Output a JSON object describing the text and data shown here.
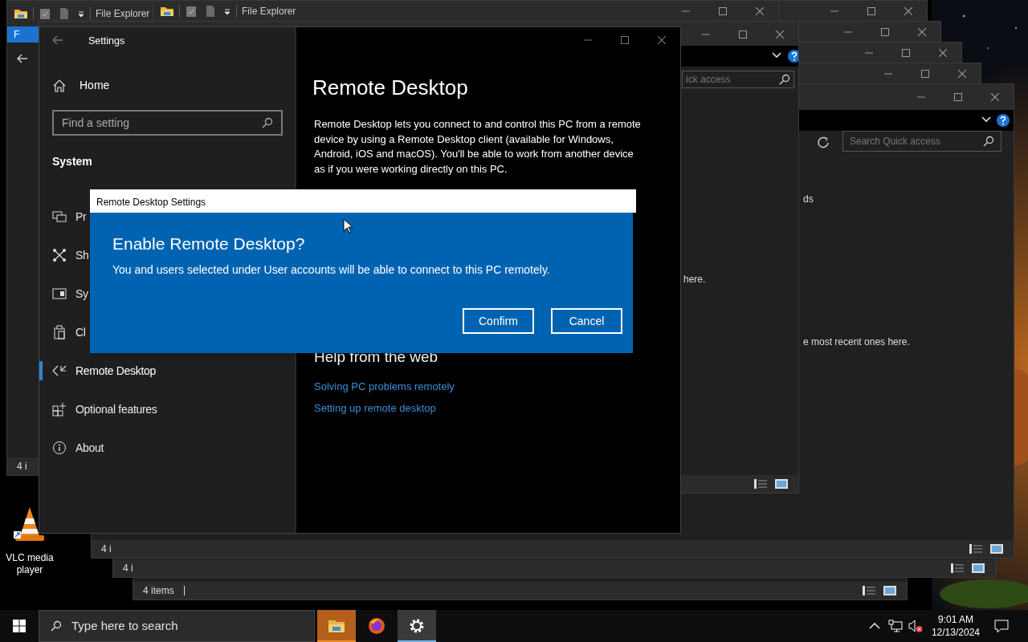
{
  "explorer_windows": [
    {
      "title": "File Explorer",
      "file_tab": "F",
      "status": "4 i"
    },
    {
      "title": "File Explorer"
    },
    {
      "search": {
        "placeholder": "ick access"
      },
      "texts": [
        "here."
      ]
    },
    {
      "search": {
        "placeholder": "Search Quick access"
      },
      "texts": [
        "ds",
        "e most recent ones here."
      ],
      "status": "4 i"
    },
    {
      "status": "4 i"
    },
    {
      "status": "4 items"
    }
  ],
  "settings": {
    "title": "Settings",
    "home": "Home",
    "search": {
      "placeholder": "Find a setting"
    },
    "section": "System",
    "nav": [
      {
        "label": "Pr",
        "selected": false
      },
      {
        "label": "Sh",
        "selected": false
      },
      {
        "label": "Sy",
        "selected": false
      },
      {
        "label": "Cl",
        "selected": false
      },
      {
        "label": "Remote Desktop",
        "selected": true
      },
      {
        "label": "Optional features",
        "selected": false
      },
      {
        "label": "About",
        "selected": false
      }
    ],
    "heading": "Remote Desktop",
    "description": "Remote Desktop lets you connect to and control this PC from a remote device by using a Remote Desktop client (available for Windows, Android, iOS and macOS). You'll be able to work from another device as if you were working directly on this PC.",
    "help_heading": "Help from the web",
    "links": [
      "Solving PC problems remotely",
      "Setting up remote desktop"
    ]
  },
  "dialog": {
    "title": "Remote Desktop Settings",
    "heading": "Enable Remote Desktop?",
    "message": "You and users selected under User accounts will be able to connect to this PC remotely.",
    "buttons": [
      "Confirm",
      "Cancel"
    ]
  },
  "desktop_icons": [
    {
      "label": "VLC media player"
    }
  ],
  "taskbar": {
    "search": {
      "placeholder": "Type here to search"
    },
    "apps": [
      {
        "selected": false,
        "attention": true
      },
      {
        "selected": false,
        "attention": false
      },
      {
        "selected": true,
        "attention": false
      }
    ],
    "tray": {
      "muted": true,
      "time": "9:01 AM",
      "date": "12/13/2024"
    }
  }
}
